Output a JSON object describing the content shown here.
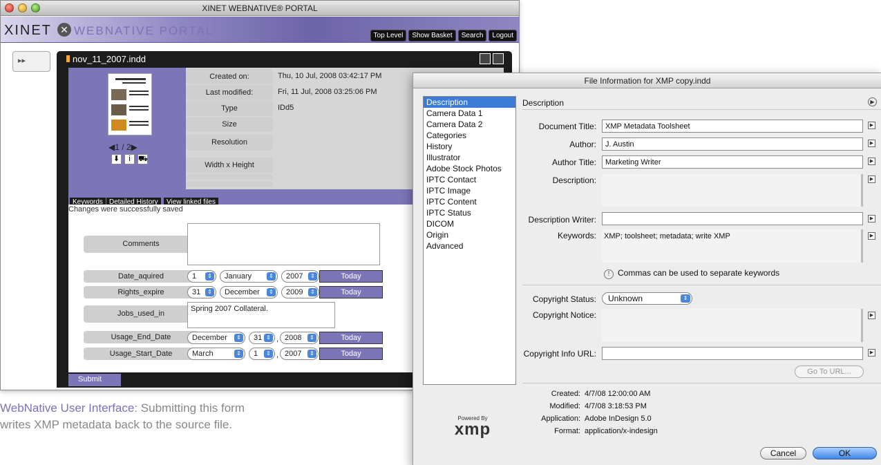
{
  "webnative": {
    "window_title": "XINET WEBNATIVE® PORTAL",
    "logo": {
      "brand": "XINET",
      "product": "WEBNATIVE PORTAL"
    },
    "nav": [
      "Top Level",
      "Show Basket",
      "Search",
      "Logout"
    ],
    "sidebar_toggle": "▸▸",
    "filename": "nov_11_2007.indd",
    "page_indicator": "◀1 / 2▶",
    "metadata": [
      {
        "label": "Created on:",
        "value": "Thu, 10 Jul, 2008 03:42:17 PM"
      },
      {
        "label": "Last modified:",
        "value": "Fri, 11 Jul, 2008 03:25:06 PM"
      },
      {
        "label": "Type",
        "value": "IDd5"
      },
      {
        "label": "Size",
        "value": ""
      },
      {
        "label": "Resolution",
        "value": ""
      },
      {
        "label": "Width x Height",
        "value": ""
      }
    ],
    "tabs": [
      "Keywords",
      "Detailed History",
      "View linked files"
    ],
    "status": "Changes were successfully saved",
    "fields": {
      "comments": {
        "label": "Comments",
        "value": ""
      },
      "date_aquired": {
        "label": "Date_aquired",
        "day": "1",
        "month": "January",
        "year": "2007",
        "button": "Today"
      },
      "rights_expire": {
        "label": "Rights_expire",
        "day": "31",
        "month": "December",
        "year": "2009",
        "button": "Today"
      },
      "jobs_used_in": {
        "label": "Jobs_used_in",
        "value": "Spring 2007 Collateral."
      },
      "usage_end": {
        "label": "Usage_End_Date",
        "month": "December",
        "day": "31",
        "year": "2008",
        "button": "Today"
      },
      "usage_start": {
        "label": "Usage_Start_Date",
        "month": "March",
        "day": "1",
        "year": "2007",
        "button": "Today"
      }
    },
    "submit": "Submit"
  },
  "caption": {
    "highlight": "WebNative User Interface",
    "line1_rest": ": Submitting this form",
    "line2": "writes XMP metadata back to the source file."
  },
  "fileinfo": {
    "title": "File Information for XMP copy.indd",
    "categories": [
      "Description",
      "Camera Data 1",
      "Camera Data 2",
      "Categories",
      "History",
      "Illustrator",
      "Adobe Stock Photos",
      "IPTC Contact",
      "IPTC Image",
      "IPTC Content",
      "IPTC Status",
      "DICOM",
      "Origin",
      "Advanced"
    ],
    "selected_category": "Description",
    "section_header": "Description",
    "labels": {
      "doc_title": "Document Title:",
      "author": "Author:",
      "author_title": "Author Title:",
      "description": "Description:",
      "desc_writer": "Description Writer:",
      "keywords": "Keywords:",
      "copyright_status": "Copyright Status:",
      "copyright_notice": "Copyright Notice:",
      "copyright_url": "Copyright Info URL:"
    },
    "values": {
      "doc_title": "XMP Metadata Toolsheet",
      "author": "J. Austin",
      "author_title": "Marketing Writer",
      "description": "",
      "desc_writer": "",
      "keywords": "XMP; toolsheet; metadata; write XMP",
      "copyright_status": "Unknown",
      "copyright_notice": "",
      "copyright_url": ""
    },
    "hint": "Commas can be used to separate keywords",
    "goto_button": "Go To URL...",
    "powered_by": "Powered By",
    "xmp_logo": "xmp",
    "file_meta": [
      {
        "label": "Created:",
        "value": "4/7/08 12:00:00 AM"
      },
      {
        "label": "Modified:",
        "value": "4/7/08 3:18:53 PM"
      },
      {
        "label": "Application:",
        "value": "Adobe InDesign 5.0"
      },
      {
        "label": "Format:",
        "value": "application/x-indesign"
      }
    ],
    "buttons": {
      "cancel": "Cancel",
      "ok": "OK"
    }
  }
}
